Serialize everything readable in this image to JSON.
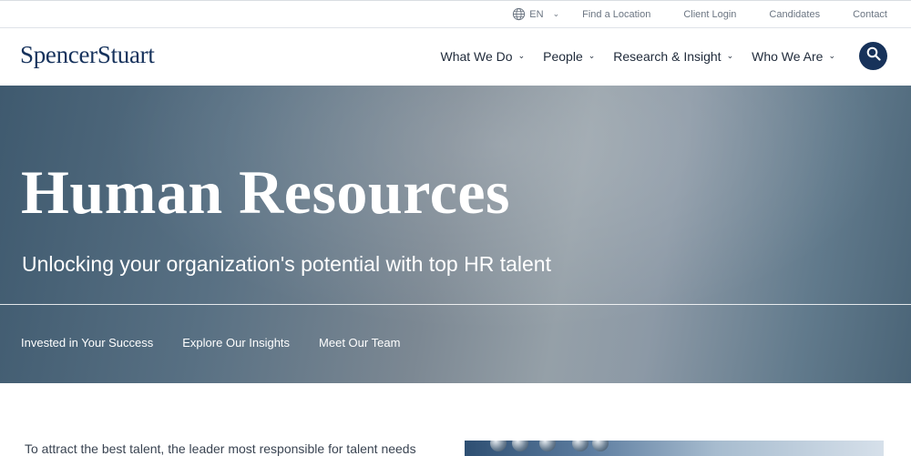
{
  "utility_bar": {
    "language": "EN",
    "links": [
      "Find a Location",
      "Client Login",
      "Candidates",
      "Contact"
    ]
  },
  "header": {
    "logo": "SpencerStuart",
    "nav": [
      "What We Do",
      "People",
      "Research & Insight",
      "Who We Are"
    ]
  },
  "hero": {
    "title": "Human Resources",
    "subtitle": "Unlocking your organization's potential with top HR talent",
    "links": [
      "Invested in Your Success",
      "Explore Our Insights",
      "Meet Our Team"
    ]
  },
  "content": {
    "intro": "To attract the best talent, the leader most responsible for talent needs"
  },
  "colors": {
    "brand_navy": "#17325a",
    "hero_gradient_start": "#3f5a6f",
    "hero_gradient_mid": "#95a0a8"
  },
  "icons": {
    "language": "globe-icon",
    "search": "search-icon",
    "dropdown": "chevron-down-icon"
  }
}
